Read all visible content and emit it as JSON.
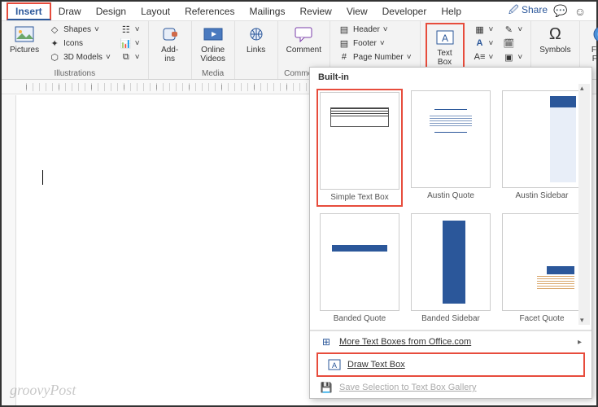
{
  "menubar": {
    "tabs": [
      "Insert",
      "Draw",
      "Design",
      "Layout",
      "References",
      "Mailings",
      "Review",
      "View",
      "Developer",
      "Help"
    ],
    "share": "Share"
  },
  "ribbon": {
    "illustrations": {
      "name": "Illustrations",
      "pictures": "Pictures",
      "shapes": "Shapes",
      "icons": "Icons",
      "models": "3D Models"
    },
    "addins": {
      "label": "Add-\nins"
    },
    "media": {
      "name": "Media",
      "videos": "Online\nVideos"
    },
    "links": {
      "label": "Links"
    },
    "comments": {
      "name": "Comments",
      "comment": "Comment"
    },
    "hf": {
      "header": "Header",
      "footer": "Footer",
      "page": "Page Number"
    },
    "textbox": {
      "label": "Text\nBox"
    },
    "symbols": {
      "name": "Symbols",
      "label": "Symbols"
    },
    "form": {
      "label": "Form\nField"
    }
  },
  "dropdown": {
    "head": "Built-in",
    "items": [
      {
        "label": "Simple Text Box"
      },
      {
        "label": "Austin Quote"
      },
      {
        "label": "Austin Sidebar"
      },
      {
        "label": "Banded Quote"
      },
      {
        "label": "Banded Sidebar"
      },
      {
        "label": "Facet Quote"
      }
    ],
    "more": "More Text Boxes from Office.com",
    "draw": "Draw Text Box",
    "save": "Save Selection to Text Box Gallery"
  },
  "watermark": "groovyPost"
}
